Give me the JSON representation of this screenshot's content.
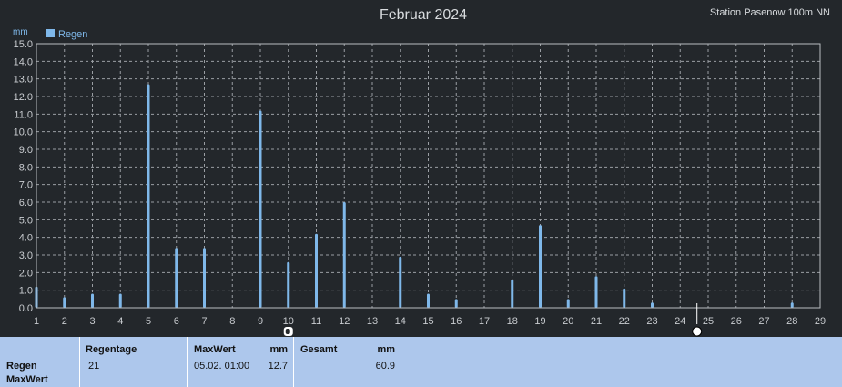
{
  "colors": {
    "background": "#23272b",
    "grid": "#9a9ea3",
    "bar": "#7fb8ea",
    "text": "#d9dcdf",
    "table_bg": "#adc7ec"
  },
  "chart_data": {
    "type": "bar",
    "title": "Februar 2024",
    "subtitle": "Station Pasenow  100m NN",
    "ylabel": "mm",
    "ylim": [
      0,
      15
    ],
    "y_ticks": [
      "0.0",
      "1.0",
      "2.0",
      "3.0",
      "4.0",
      "5.0",
      "6.0",
      "7.0",
      "8.0",
      "9.0",
      "10.0",
      "11.0",
      "12.0",
      "13.0",
      "14.0",
      "15.0"
    ],
    "x_ticks": [
      "1",
      "2",
      "3",
      "4",
      "5",
      "6",
      "7",
      "8",
      "9",
      "10",
      "11",
      "12",
      "13",
      "14",
      "15",
      "16",
      "17",
      "18",
      "19",
      "20",
      "21",
      "22",
      "23",
      "24",
      "25",
      "26",
      "27",
      "28",
      "29"
    ],
    "xlim": [
      1,
      29
    ],
    "grid": true,
    "legend": "top-left",
    "series": [
      {
        "name": "Regen",
        "x": [
          1,
          2,
          3,
          4,
          5,
          6,
          7,
          9,
          10,
          11,
          12,
          14,
          15,
          16,
          18,
          19,
          20,
          21,
          22,
          23,
          28
        ],
        "values": [
          1.2,
          0.6,
          0.8,
          0.8,
          12.7,
          3.4,
          3.4,
          11.2,
          2.6,
          4.2,
          6.0,
          2.9,
          0.8,
          0.5,
          1.6,
          4.7,
          0.5,
          1.8,
          1.1,
          0.3,
          0.3
        ]
      }
    ]
  },
  "table": {
    "row_label_1": "Regen",
    "row_label_2": "MaxWert",
    "regentage_header": "Regentage",
    "regentage_value": "21",
    "maxwert_header": "MaxWert",
    "maxwert_unit": "mm",
    "maxwert_datetime": "05.02.  01:00",
    "maxwert_value": "12.7",
    "gesamt_header": "Gesamt",
    "gesamt_unit": "mm",
    "gesamt_value": "60.9"
  }
}
